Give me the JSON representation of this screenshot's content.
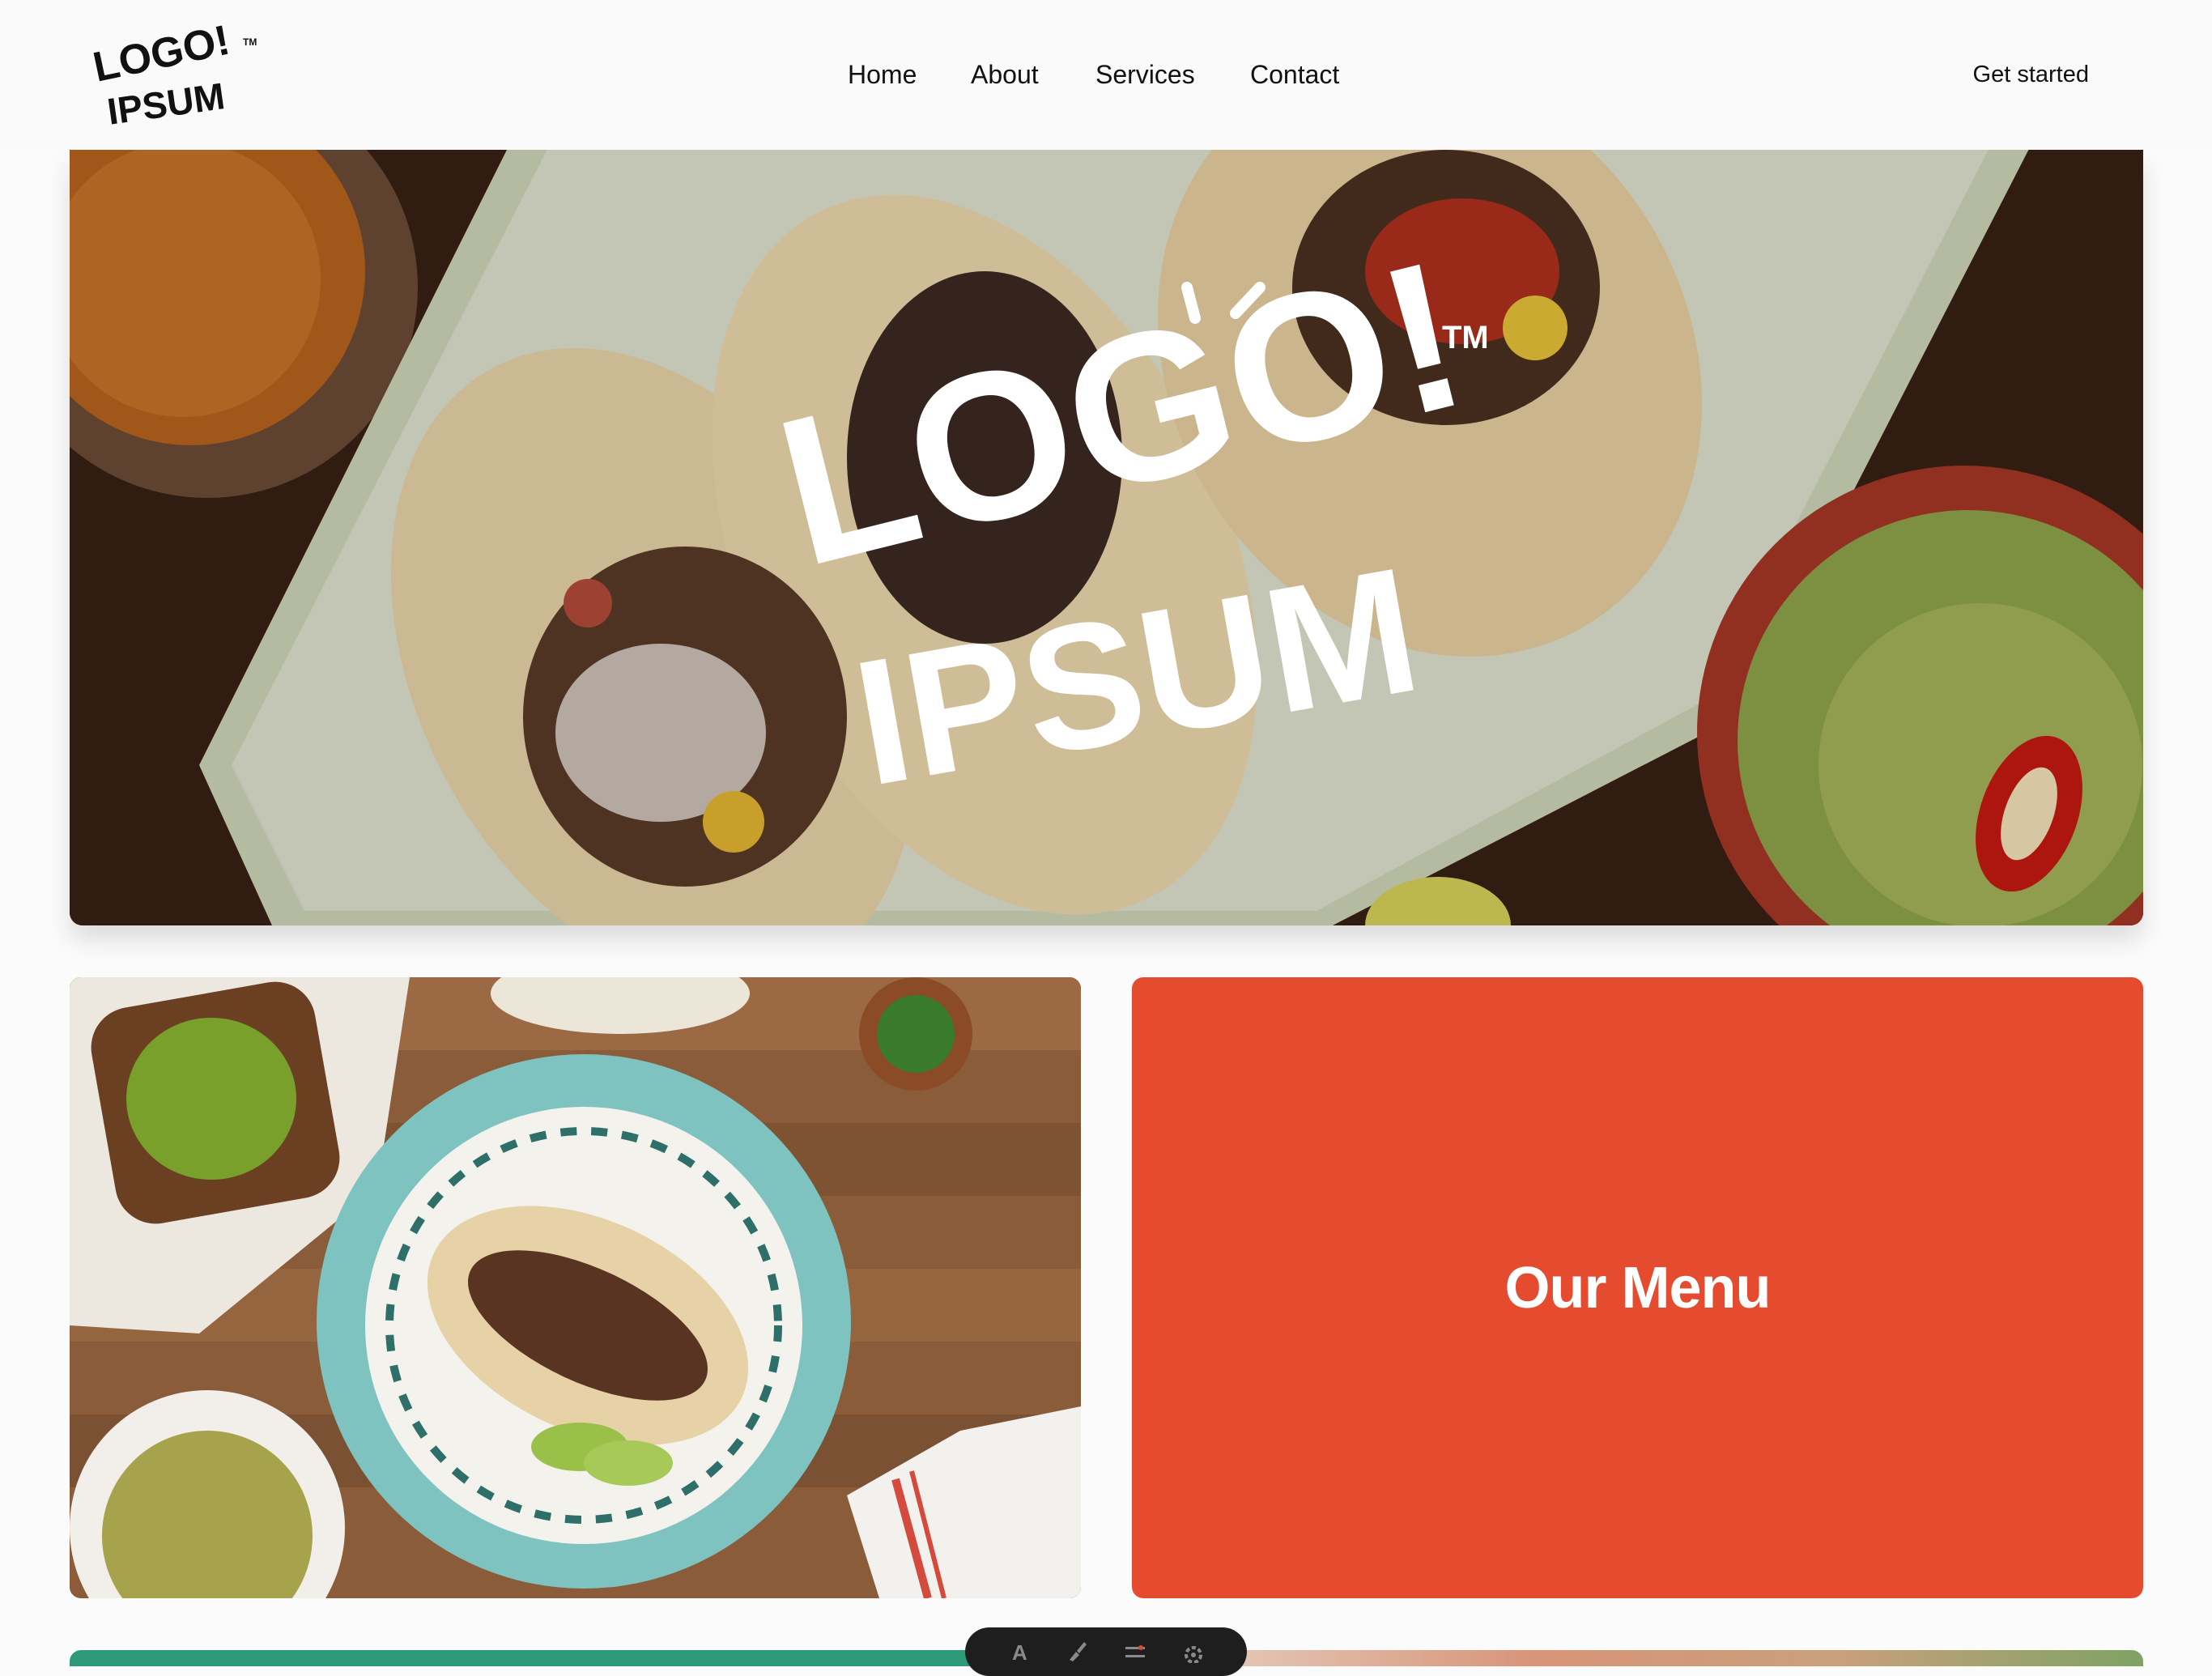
{
  "header": {
    "logo_alt": "LOGO! IPSUM",
    "nav": [
      {
        "label": "Home"
      },
      {
        "label": "About"
      },
      {
        "label": "Services"
      },
      {
        "label": "Contact"
      }
    ],
    "cta_label": "Get started"
  },
  "hero": {
    "logo_text_top": "LOGO!",
    "logo_text_bottom": "IPSUM",
    "trademark": "TM",
    "image_subject": "tacos-on-plate-photo"
  },
  "cards": {
    "photo_subject": "tacos-and-guacamole-photo",
    "menu_label": "Our Menu"
  },
  "toolbar": {
    "icons": [
      "text-icon",
      "brush-icon",
      "adjust-icon",
      "settings-icon"
    ]
  },
  "colors": {
    "accent": "#e54c2f",
    "header_bg": "#fafafa",
    "peek_green": "#2f9a7a",
    "toolbar_bg": "#1e1e1e"
  }
}
